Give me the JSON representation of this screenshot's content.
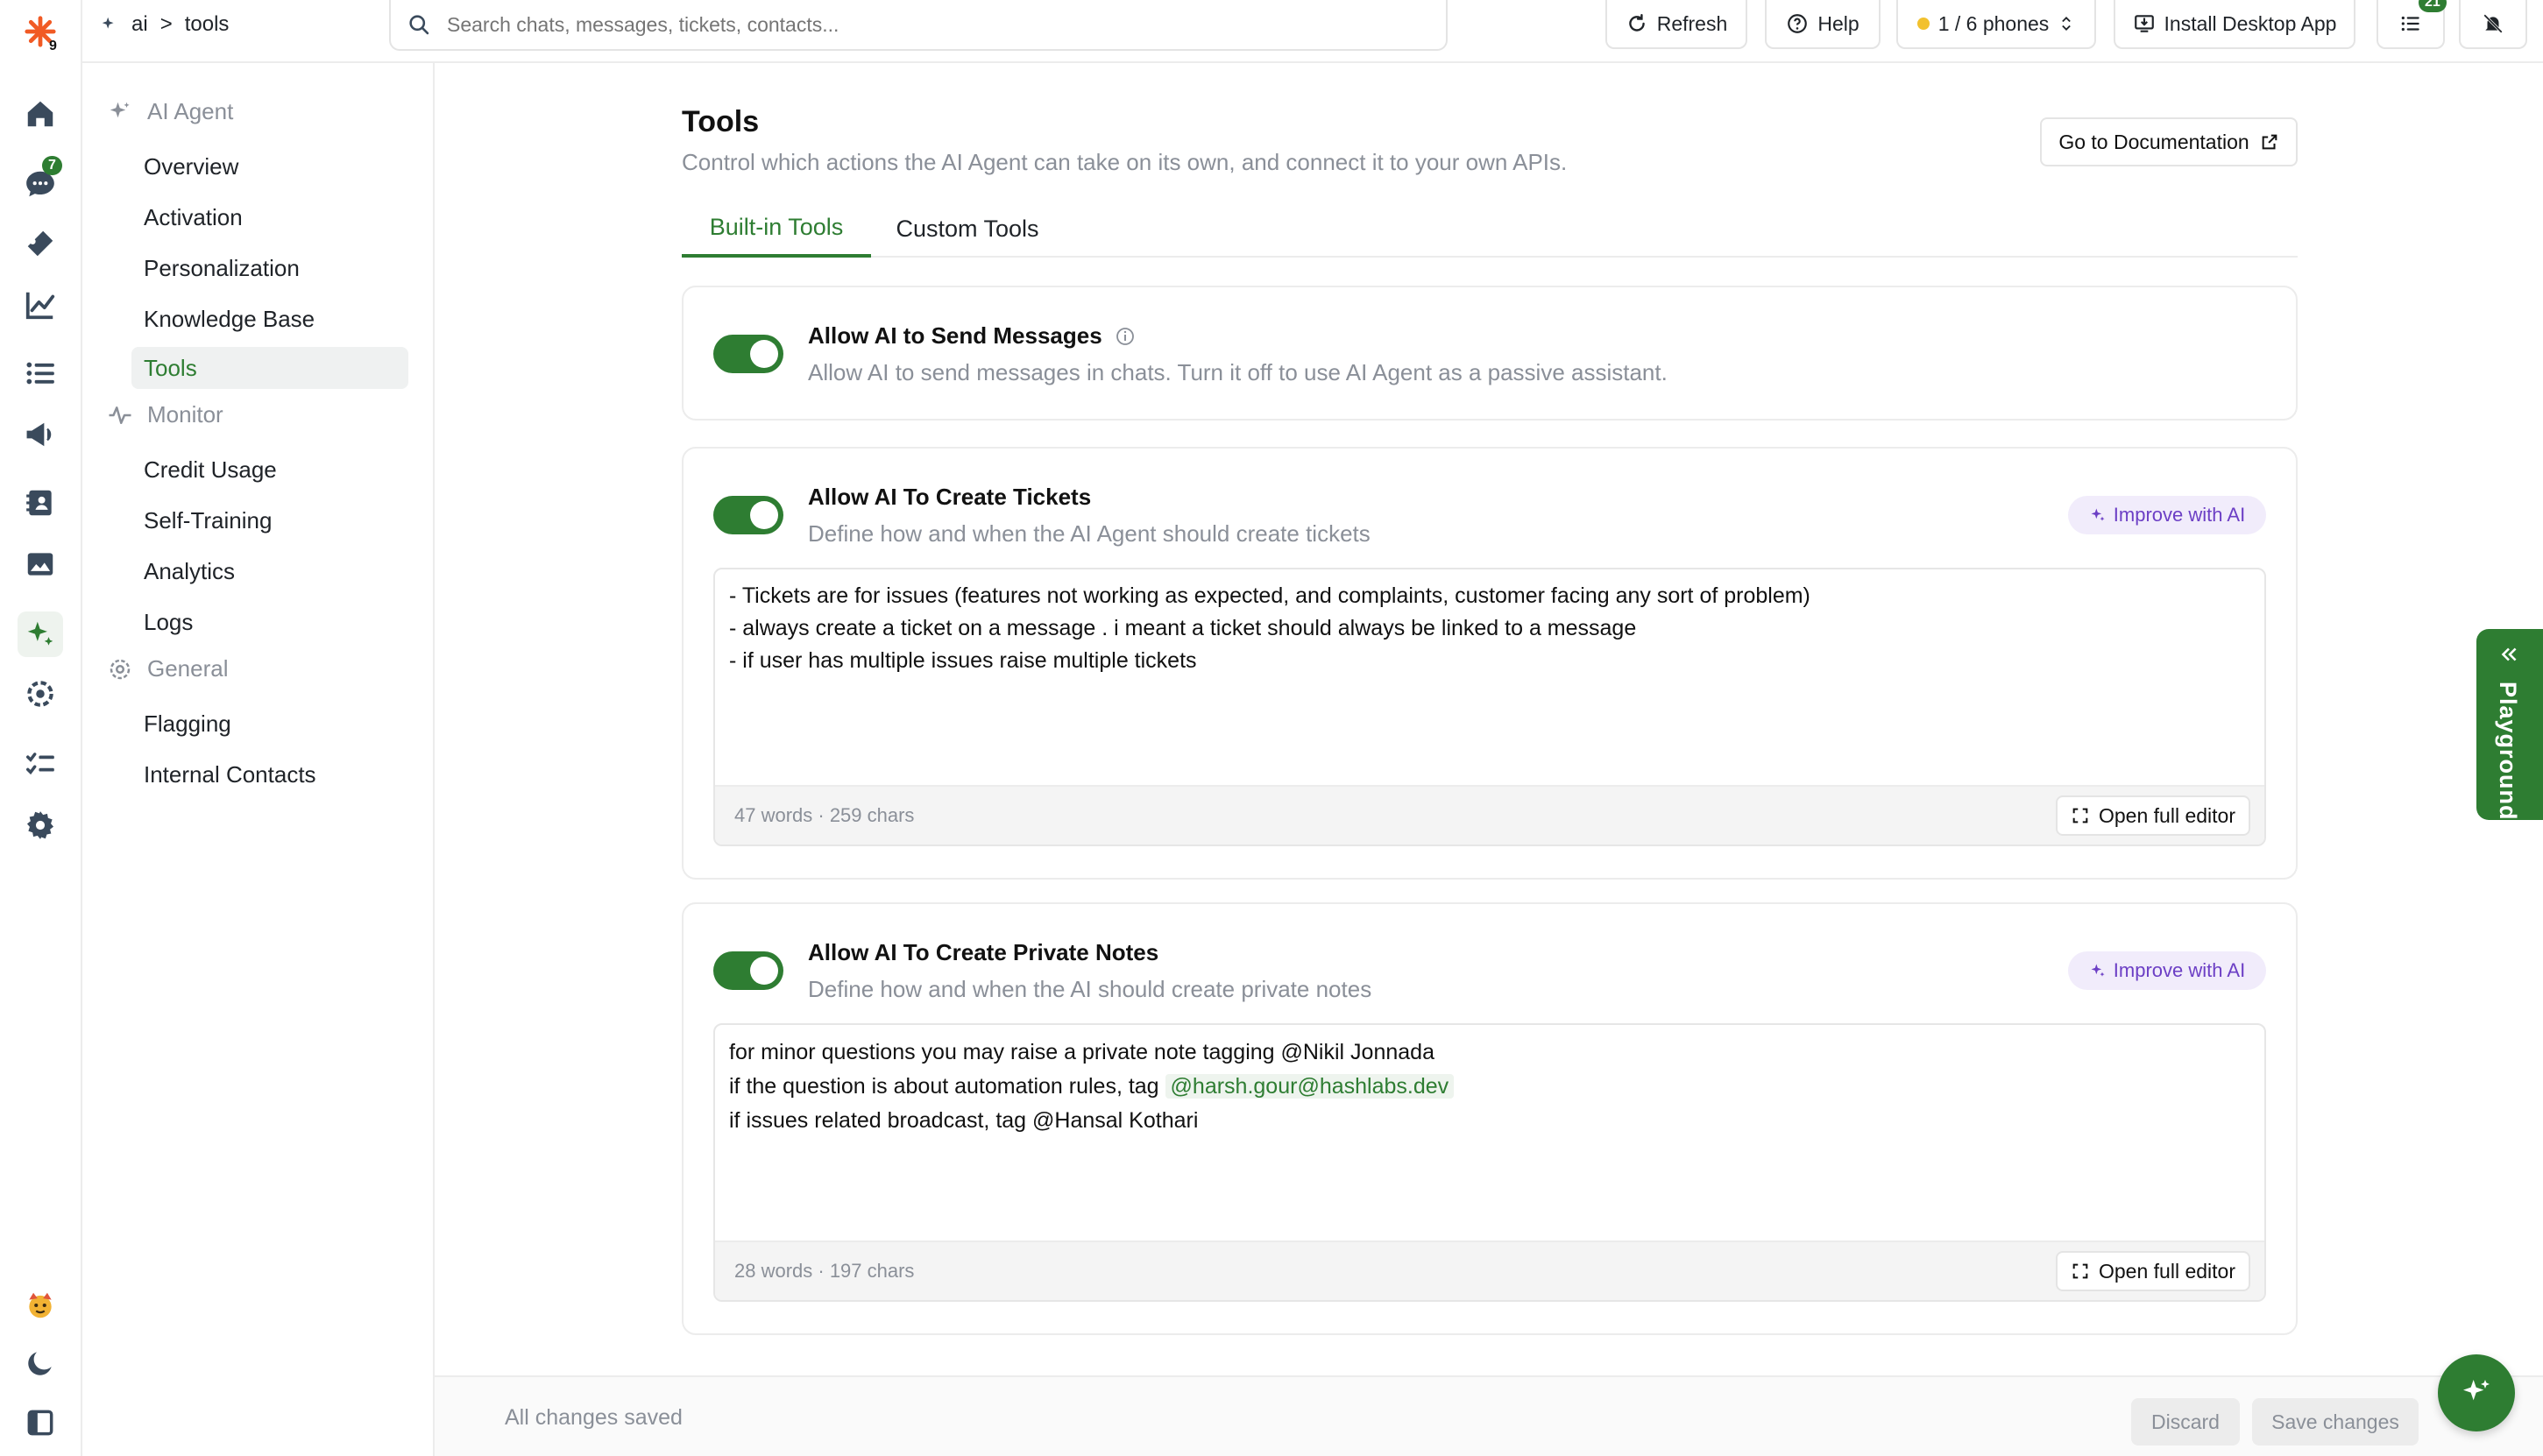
{
  "rail": {
    "logo_badge": "9",
    "chats_badge": "7"
  },
  "topbar": {
    "breadcrumb": {
      "root": "ai",
      "separator": ">",
      "current": "tools"
    },
    "search_placeholder": "Search chats, messages, tickets, contacts...",
    "refresh_label": "Refresh",
    "help_label": "Help",
    "phones_label": "1 / 6 phones",
    "install_label": "Install Desktop App",
    "list_badge": "21"
  },
  "sidenav": {
    "sections": [
      {
        "label": "AI Agent",
        "items": [
          "Overview",
          "Activation",
          "Personalization",
          "Knowledge Base",
          "Tools"
        ]
      },
      {
        "label": "Monitor",
        "items": [
          "Credit Usage",
          "Self-Training",
          "Analytics",
          "Logs"
        ]
      },
      {
        "label": "General",
        "items": [
          "Flagging",
          "Internal Contacts"
        ]
      }
    ],
    "active": "Tools"
  },
  "page": {
    "title": "Tools",
    "subtitle": "Control which actions the AI Agent can take on its own, and connect it to your own APIs.",
    "doc_button": "Go to Documentation",
    "tabs": [
      "Built-in Tools",
      "Custom Tools"
    ],
    "active_tab": "Built-in Tools"
  },
  "cards": [
    {
      "title": "Allow AI to Send Messages",
      "description": "Allow AI to send messages in chats. Turn it off to use AI Agent as a passive assistant.",
      "enabled": true
    },
    {
      "title": "Allow AI To Create Tickets",
      "description": "Define how and when the AI Agent should create tickets",
      "enabled": true,
      "improve_label": "Improve with AI",
      "lines": [
        "- Tickets are for issues (features not working as expected, and complaints, customer facing any sort of problem)",
        "- always create a ticket on a message . i meant a ticket should always be linked to a message",
        "- if user has multiple issues raise multiple tickets"
      ],
      "count": "47 words · 259 chars",
      "open_editor_label": "Open full editor"
    },
    {
      "title": "Allow AI To Create Private Notes",
      "description": "Define how and when the AI should create private notes",
      "enabled": true,
      "improve_label": "Improve with AI",
      "lines": [
        "for minor questions you may raise a private note tagging @Nikil Jonnada",
        "if the question is about automation rules, tag",
        "if issues related broadcast, tag @Hansal Kothari"
      ],
      "mention": "@harsh.gour@hashlabs.dev",
      "count": "28 words · 197 chars",
      "open_editor_label": "Open full editor"
    }
  ],
  "footer": {
    "status": "All changes saved",
    "discard_label": "Discard",
    "save_label": "Save changes"
  },
  "playground_label": "Playground",
  "colors": {
    "accent": "#2e7d32",
    "improve_bg": "#f1ecfb",
    "improve_text": "#6c3fc5",
    "brand_logo": "#f15a24"
  }
}
